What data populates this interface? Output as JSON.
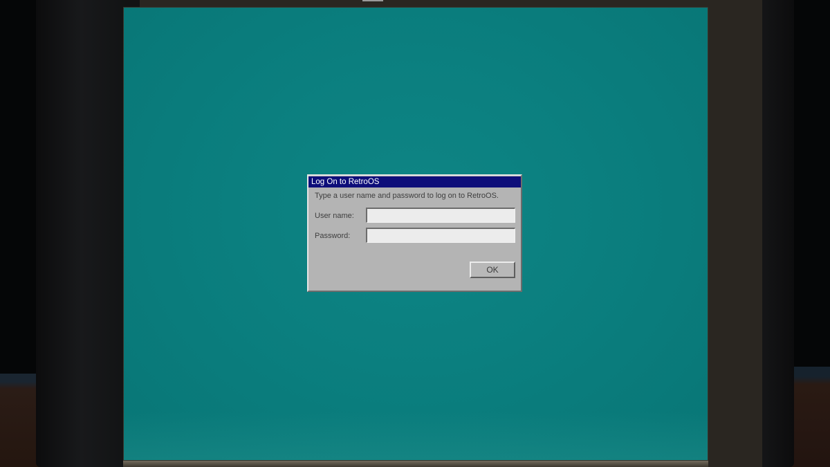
{
  "dialog": {
    "title": "Log On to RetroOS",
    "instructions": "Type a user name and password to log on to RetroOS.",
    "username_label": "User name:",
    "username_value": "",
    "password_label": "Password:",
    "password_value": "",
    "ok_label": "OK"
  },
  "colors": {
    "desktop": "#0b7f7f",
    "title_bar": "#0e0e7a",
    "dialog_face": "#b4b4b4"
  }
}
